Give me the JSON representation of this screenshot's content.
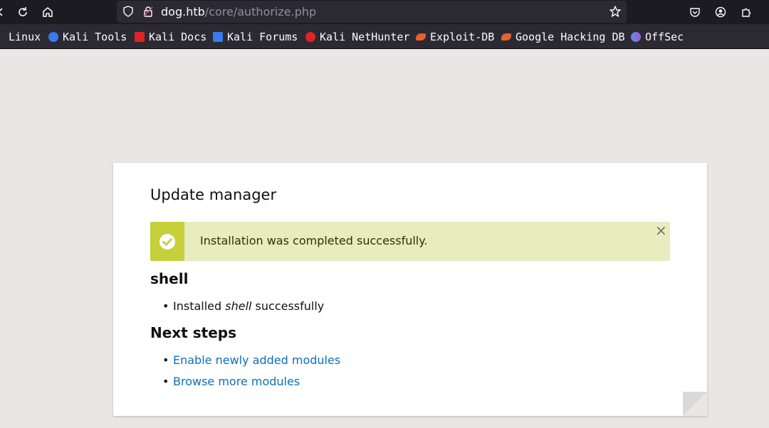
{
  "browser": {
    "url_host": "dog.htb",
    "url_path": "/core/authorize.php",
    "bookmarks": [
      {
        "label": "Linux",
        "color": "#367bf0"
      },
      {
        "label": "Kali Tools",
        "color": "#367bf0"
      },
      {
        "label": "Kali Docs",
        "color": "#e02424"
      },
      {
        "label": "Kali Forums",
        "color": "#367bf0"
      },
      {
        "label": "Kali NetHunter",
        "color": "#e02424"
      },
      {
        "label": "Exploit-DB",
        "color": "#e8612c"
      },
      {
        "label": "Google Hacking DB",
        "color": "#e8612c"
      },
      {
        "label": "OffSec",
        "color": "#7b5bd6"
      }
    ]
  },
  "page": {
    "title": "Update manager",
    "status_message": "Installation was completed successfully.",
    "close_symbol": "×",
    "module_heading": "shell",
    "installed_prefix": "Installed ",
    "installed_module": "shell",
    "installed_suffix": " successfully",
    "next_steps_heading": "Next steps",
    "links": [
      "Enable newly added modules",
      "Browse more modules"
    ]
  },
  "colors": {
    "status_bg": "#e7edbf",
    "status_accent": "#c5d03a",
    "link": "#0c70b8"
  }
}
